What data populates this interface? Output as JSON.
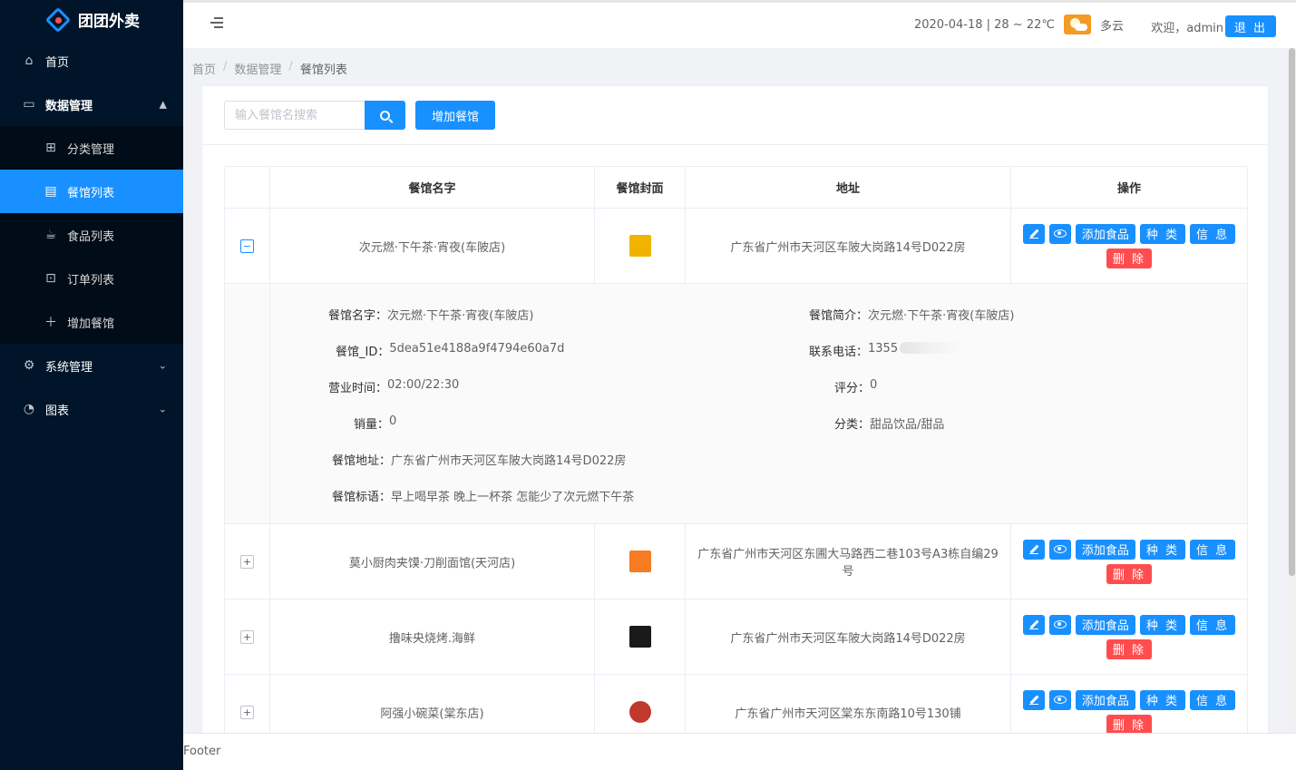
{
  "app": {
    "title": "团团外卖"
  },
  "sidebar": {
    "items": [
      {
        "label": "首页",
        "icon": "home-icon"
      },
      {
        "label": "数据管理",
        "icon": "laptop-icon",
        "expanded": true,
        "children": [
          {
            "label": "分类管理",
            "icon": "grid-icon"
          },
          {
            "label": "餐馆列表",
            "icon": "table-icon",
            "active": true
          },
          {
            "label": "食品列表",
            "icon": "coffee-cup-icon"
          },
          {
            "label": "订单列表",
            "icon": "order-icon"
          },
          {
            "label": "增加餐馆",
            "icon": "plus-icon"
          }
        ]
      },
      {
        "label": "系统管理",
        "icon": "gear-icon"
      },
      {
        "label": "图表",
        "icon": "pie-chart-icon"
      }
    ]
  },
  "header": {
    "weather_text": "2020-04-18 | 28 ~ 22℃",
    "weather_desc": "多云",
    "welcome": "欢迎，admin",
    "logout": "退 出"
  },
  "breadcrumb": [
    "首页",
    "数据管理",
    "餐馆列表"
  ],
  "toolbar": {
    "search_placeholder": "输入餐馆名搜索",
    "add_label": "增加餐馆"
  },
  "table": {
    "columns": [
      "餐馆名字",
      "餐馆封面",
      "地址",
      "操作"
    ],
    "actions": {
      "add_food": "添加食品",
      "category": "种 类",
      "info": "信 息",
      "delete": "删 除"
    },
    "rows": [
      {
        "name": "次元燃·下午茶·宵夜(车陂店)",
        "address": "广东省广州市天河区车陂大岗路14号D022房",
        "cover_color": "#f0b400",
        "expanded": true
      },
      {
        "name": "莫小厨肉夹馍·刀削面馆(天河店)",
        "address": "广东省广州市天河区东圃大马路西二巷103号A3栋自编29号",
        "cover_color": "#f57c20"
      },
      {
        "name": "撸味央烧烤.海鲜",
        "address": "广东省广州市天河区车陂大岗路14号D022房",
        "cover_color": "#1a1a1a"
      },
      {
        "name": "阿强小碗菜(棠东店)",
        "address": "广东省广州市天河区棠东东南路10号130铺",
        "cover_color": "#c0392b"
      }
    ],
    "detail": {
      "name_label": "餐馆名字：",
      "name": "次元燃·下午茶·宵夜(车陂店)",
      "intro_label": "餐馆简介：",
      "intro": "次元燃·下午茶·宵夜(车陂店)",
      "id_label": "餐馆_ID：",
      "id": "5dea51e4188a9f4794e60a7d",
      "phone_label": "联系电话：",
      "phone": "1355",
      "hours_label": "营业时间：",
      "hours": "02:00/22:30",
      "rating_label": "评分：",
      "rating": "0",
      "sales_label": "销量：",
      "sales": "0",
      "category_label": "分类：",
      "category": "甜品饮品/甜品",
      "address_label": "餐馆地址：",
      "address": "广东省广州市天河区车陂大岗路14号D022房",
      "slogan_label": "餐馆标语：",
      "slogan": "早上喝早茶 晚上一杯茶 怎能少了次元燃下午茶"
    }
  },
  "footer": {
    "text": "Footer"
  }
}
